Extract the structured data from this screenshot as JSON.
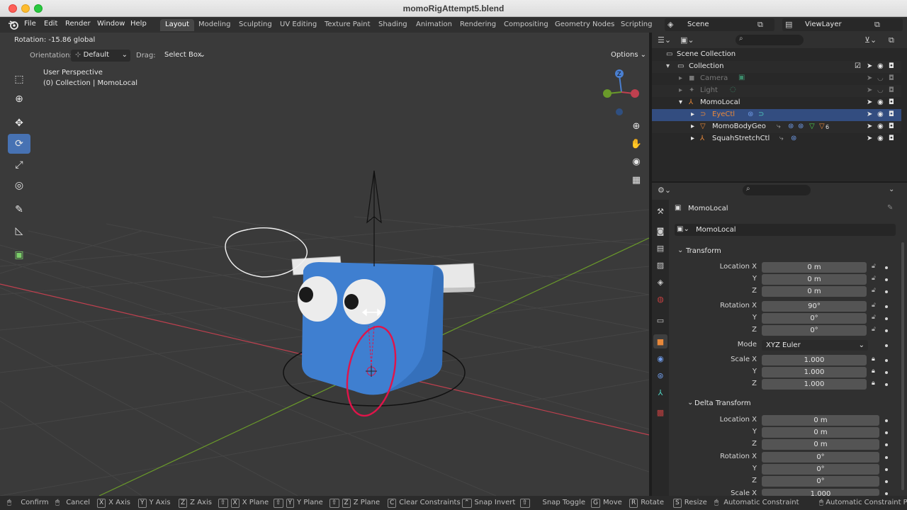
{
  "window": {
    "title": "momoRigAttempt5.blend"
  },
  "menu": {
    "file": "File",
    "edit": "Edit",
    "render": "Render",
    "window": "Window",
    "help": "Help"
  },
  "workspaces": [
    "Layout",
    "Modeling",
    "Sculpting",
    "UV Editing",
    "Texture Paint",
    "Shading",
    "Animation",
    "Rendering",
    "Compositing",
    "Geometry Nodes",
    "Scripting"
  ],
  "active_workspace": "Layout",
  "scene": {
    "label": "Scene",
    "view_layer": "ViewLayer"
  },
  "viewport": {
    "operator_status": "Rotation: -15.86 global",
    "orientation_label": "Orientation:",
    "orientation_value": "Default",
    "drag_label": "Drag:",
    "drag_value": "Select Box",
    "options": "Options",
    "perspective": "User Perspective",
    "collection_info": "(0) Collection | MomoLocal",
    "gizmo_axis_label": "Z"
  },
  "outliner": {
    "scene_collection": "Scene Collection",
    "collection": "Collection",
    "camera": "Camera",
    "light": "Light",
    "momolocal": "MomoLocal",
    "eyectl": "EyeCtl",
    "body_geo": "MomoBodyGeo",
    "squash": "SquahStretchCtl",
    "body_geo_badge": "6"
  },
  "properties": {
    "object_name": "MomoLocal",
    "datablock_name": "MomoLocal",
    "transform_label": "Transform",
    "location_label": "Location X",
    "location": [
      "0 m",
      "0 m",
      "0 m"
    ],
    "rotation_label": "Rotation X",
    "rotation": [
      "90°",
      "0°",
      "0°"
    ],
    "mode_label": "Mode",
    "mode_value": "XYZ Euler",
    "scale_label": "Scale X",
    "scale": [
      "1.000",
      "1.000",
      "1.000"
    ],
    "delta_label": "Delta Transform",
    "delta_location": [
      "0 m",
      "0 m",
      "0 m"
    ],
    "delta_rotation": [
      "0°",
      "0°",
      "0°"
    ],
    "delta_scale_x": "1.000",
    "y": "Y",
    "z": "Z"
  },
  "statusbar": {
    "confirm": "Confirm",
    "cancel": "Cancel",
    "x_axis_key": "X",
    "x_axis": "X Axis",
    "y_axis_key": "Y",
    "y_axis": "Y Axis",
    "z_axis_key": "Z",
    "z_axis": "Z Axis",
    "x_plane_key": "X",
    "x_plane": "X Plane",
    "y_plane_key": "Y",
    "y_plane": "Y Plane",
    "z_plane_key": "Z",
    "z_plane": "Z Plane",
    "clear_key": "C",
    "clear": "Clear Constraints",
    "snap_invert": "Snap Invert",
    "snap_toggle": "Snap Toggle",
    "move_key": "G",
    "move": "Move",
    "rotate_key": "R",
    "rotate": "Rotate",
    "resize_key": "S",
    "resize": "Resize",
    "auto_constraint": "Automatic Constraint",
    "auto_constraint_plane": "Automatic Constraint Plane"
  },
  "colors": {
    "accent": "#4772b3",
    "selected_row": "#334d80",
    "body_blue": "#3f7fd0",
    "eye_ctl_orange": "#e8883a",
    "red_axis": "#c0404f",
    "green_axis": "#6a9a2a",
    "control_ring": "#e0144a"
  }
}
